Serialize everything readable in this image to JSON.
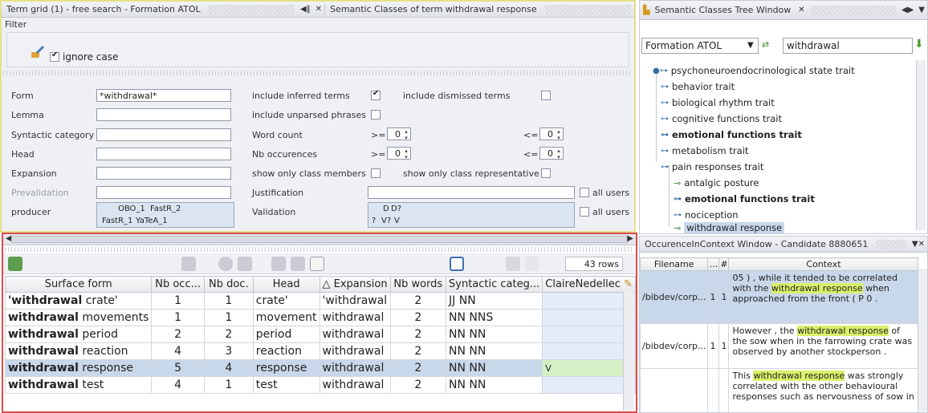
{
  "left_top": {
    "title_tab1": "Term grid (1) - free search - Formation ATOL",
    "title_tab2": "Semantic Classes of term withdrawal response",
    "filter_label": "Filter",
    "ignore_case_label": "ignore case",
    "form_label": "Form",
    "form_value": "*withdrawal*",
    "lemma_label": "Lemma",
    "syntactic_label": "Syntactic category",
    "head_label": "Head",
    "expansion_label": "Expansion",
    "prevalidation_label": "Prevalidation",
    "producer_label": "producer",
    "producers": [
      "OBO_1",
      "FastR_2",
      "FastR_1",
      "YaTeA_1"
    ],
    "include_inferred": "include inferred terms",
    "include_dismissed": "include dismissed terms",
    "include_unparsed": "include unparsed phrases",
    "word_count": "Word count",
    "nb_occurrences": "Nb occurences",
    "ge": ">=",
    "le": "<=",
    "zero": "0",
    "show_members": "show only class members",
    "show_representative": "show only class representative",
    "justification": "Justification",
    "validation": "Validation",
    "all_users": "all users",
    "validation_codes": [
      "D",
      "D?",
      "?",
      "V?",
      "V"
    ]
  },
  "grid": {
    "rows_count": "43 rows",
    "columns": [
      "Surface form",
      "Nb occ...",
      "Nb doc.",
      "Head",
      "△ Expansion",
      "Nb words",
      "Syntactic categ...",
      "ClaireNedellec"
    ],
    "rows": [
      {
        "pre": "'",
        "bold": "withdrawal",
        "rest": " crate'",
        "occ": "1",
        "doc": "1",
        "head": "crate'",
        "exp": "'withdrawal",
        "words": "2",
        "syn": "JJ NN",
        "claire": ""
      },
      {
        "pre": "",
        "bold": "withdrawal",
        "rest": " movements",
        "occ": "1",
        "doc": "1",
        "head": "movement",
        "exp": "withdrawal",
        "words": "2",
        "syn": "NN NNS",
        "claire": ""
      },
      {
        "pre": "",
        "bold": "withdrawal",
        "rest": " period",
        "occ": "2",
        "doc": "2",
        "head": "period",
        "exp": "withdrawal",
        "words": "2",
        "syn": "NN NN",
        "claire": ""
      },
      {
        "pre": "",
        "bold": "withdrawal",
        "rest": " reaction",
        "occ": "4",
        "doc": "3",
        "head": "reaction",
        "exp": "withdrawal",
        "words": "2",
        "syn": "NN NN",
        "claire": ""
      },
      {
        "pre": "",
        "bold": "withdrawal",
        "rest": " response",
        "occ": "5",
        "doc": "4",
        "head": "response",
        "exp": "withdrawal",
        "words": "2",
        "syn": "NN NN",
        "claire": "V"
      },
      {
        "pre": "",
        "bold": "withdrawal",
        "rest": " test",
        "occ": "4",
        "doc": "1",
        "head": "test",
        "exp": "withdrawal",
        "words": "2",
        "syn": "NN NN",
        "claire": ""
      }
    ]
  },
  "tree": {
    "title": "Semantic Classes Tree Window",
    "ontology": "Formation ATOL",
    "search": "withdrawal",
    "items": [
      "psychoneuroendocrinological state trait",
      "behavior trait",
      "biological rhythm trait",
      "cognitive functions trait",
      "emotional functions trait",
      "metabolism trait",
      "pain responses trait",
      "antalgic posture",
      "emotional functions trait",
      "nociception",
      "withdrawal response"
    ]
  },
  "occ": {
    "title": "OccurenceInContext Window - Candidate 8880651",
    "columns": [
      "Filename",
      "...",
      "#",
      "Context"
    ],
    "rows": [
      {
        "file": "/bibdev/corp...",
        "a": "1",
        "b": "1",
        "pre": "05 ) , while it tended to be correlated with the ",
        "hl": "withdrawal response",
        "post": " when approached from the front ( P 0 ."
      },
      {
        "file": "/bibdev/corp...",
        "a": "1",
        "b": "1",
        "pre": "However , the ",
        "hl": "withdrawal response",
        "post": " of the sow when in the farrowing crate was observed by another stockperson ."
      },
      {
        "file": "",
        "a": "",
        "b": "",
        "pre": "This ",
        "hl": "withdrawal response",
        "post": " was strongly correlated with the other behavioural responses such as nervousness of sow in"
      }
    ]
  }
}
